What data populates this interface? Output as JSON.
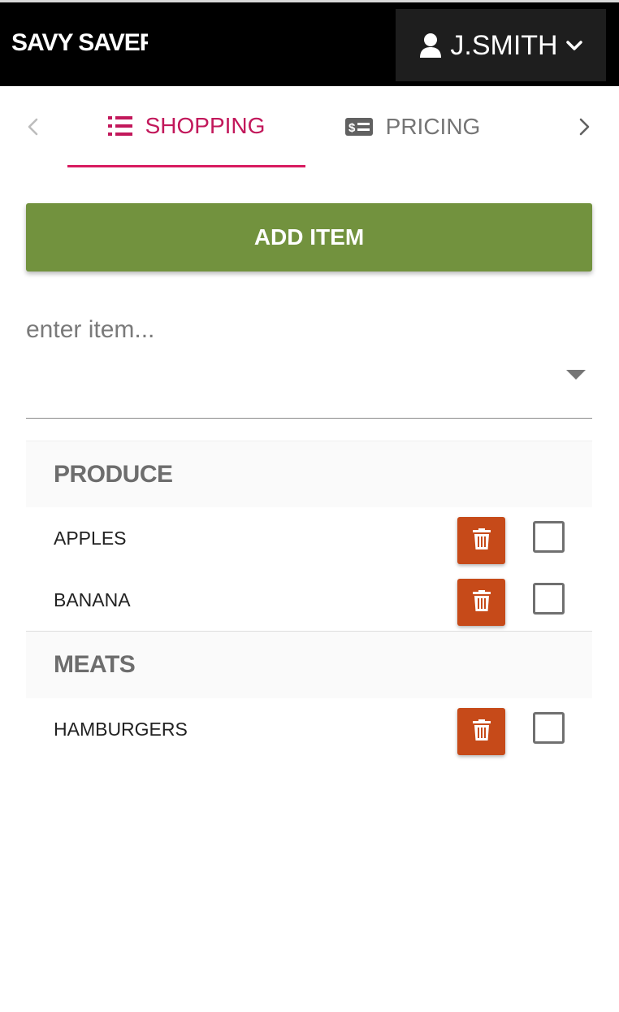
{
  "header": {
    "brand": "SAVY SAVER",
    "user_name": "J.SMITH",
    "icons": {
      "user": "user-icon",
      "chevron": "chevron-down-icon"
    }
  },
  "tabs": [
    {
      "label": "SHOPPING",
      "icon": "list-icon",
      "active": true
    },
    {
      "label": "PRICING",
      "icon": "price-tag-icon",
      "active": false
    }
  ],
  "add_item": {
    "label": "ADD ITEM"
  },
  "item_input": {
    "placeholder": "enter item...",
    "value": ""
  },
  "categories": [
    {
      "name": "PRODUCE",
      "items": [
        {
          "name": "APPLES",
          "checked": false
        },
        {
          "name": "BANANA",
          "checked": false
        }
      ]
    },
    {
      "name": "MEATS",
      "items": [
        {
          "name": "HAMBURGERS",
          "checked": false
        }
      ]
    }
  ],
  "colors": {
    "header_bg": "#000000",
    "active_tab": "#c2185b",
    "add_button": "#72923e",
    "delete_button": "#c64a19"
  }
}
